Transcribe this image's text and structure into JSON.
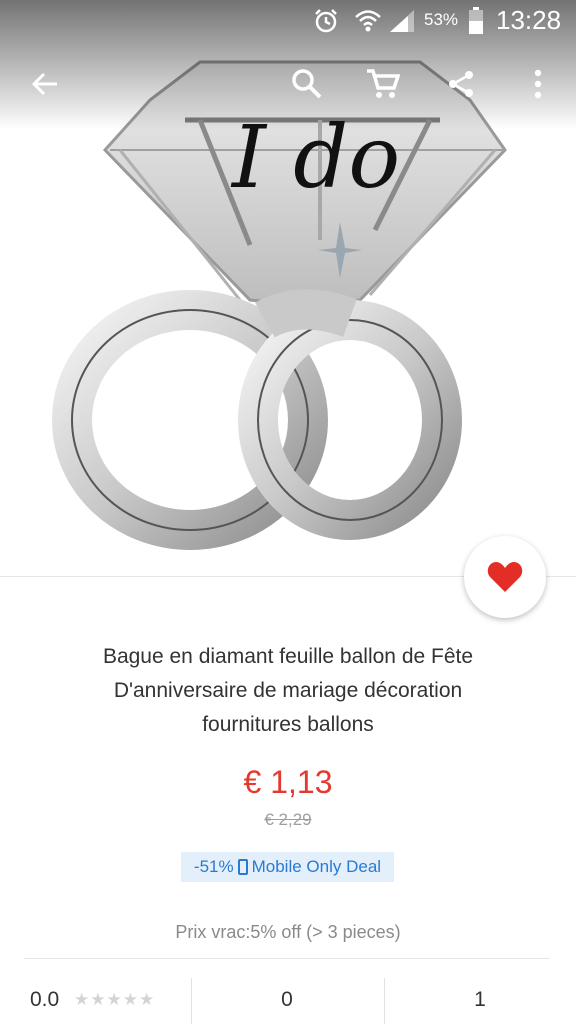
{
  "status_bar": {
    "battery_percent": "53%",
    "time": "13:28",
    "icons": [
      "alarm-icon",
      "wifi-icon",
      "signal-icon",
      "battery-icon"
    ]
  },
  "toolbar": {
    "icons": [
      "back-arrow-icon",
      "search-icon",
      "cart-icon",
      "share-icon",
      "more-vert-icon"
    ]
  },
  "product": {
    "image_text": "I do",
    "title_lines": [
      "Bague en diamant feuille ballon de Fête",
      "D'anniversaire de mariage décoration",
      "fournitures ballons"
    ],
    "price": "€ 1,13",
    "original_price": "€ 2,29",
    "deal": {
      "discount": "-51%",
      "label": "Mobile Only Deal"
    },
    "bulk_price": "Prix vrac:5% off (> 3 pieces)"
  },
  "stats": {
    "rating": "0.0",
    "stars": "★★★★★",
    "stat_2": "0",
    "stat_3": "1"
  },
  "colors": {
    "price": "#e4392f",
    "deal_bg": "#e3f0fb",
    "deal_text": "#2a7ad2",
    "wishlist_heart": "#e52d27"
  }
}
